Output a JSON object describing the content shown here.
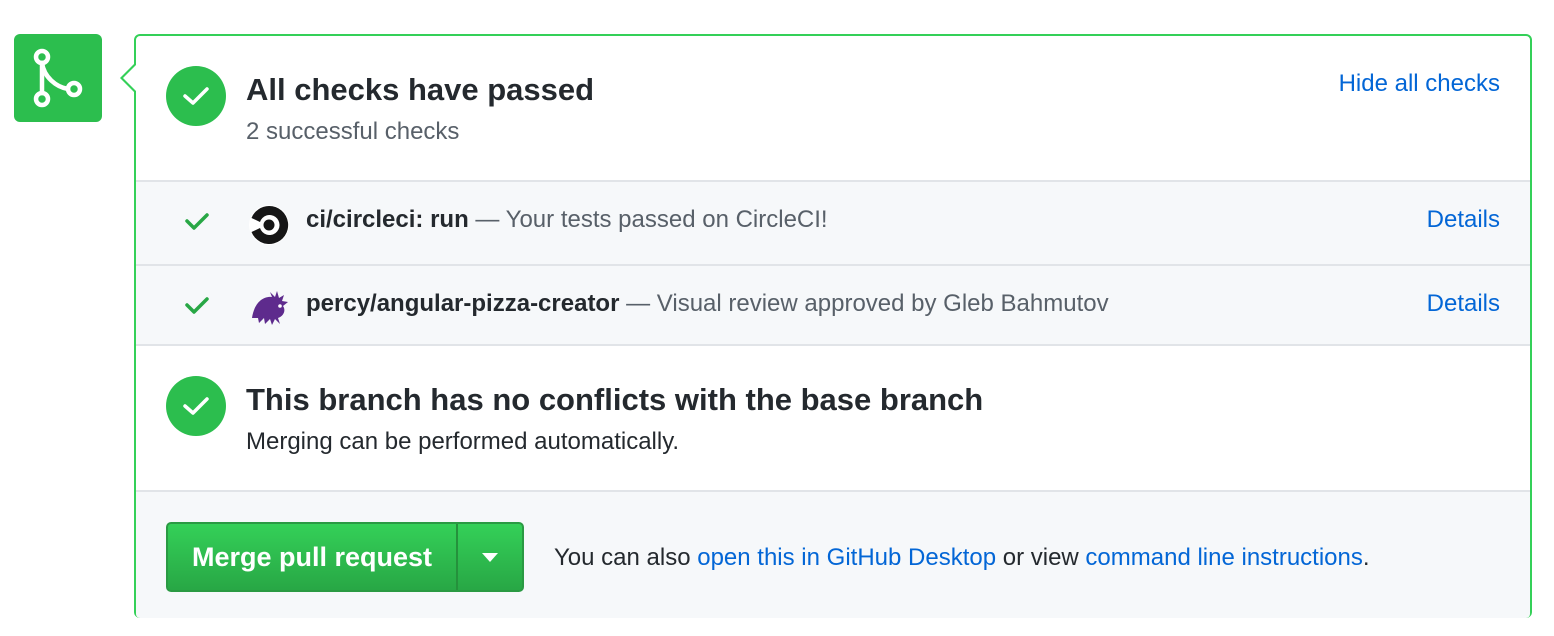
{
  "summary": {
    "title": "All checks have passed",
    "subtitle": "2 successful checks",
    "toggle_link": "Hide all checks"
  },
  "checks": [
    {
      "context": "ci/circleci: run",
      "separator": " — ",
      "description": "Your tests passed on CircleCI!",
      "details_label": "Details",
      "icon": "circleci-logo-icon"
    },
    {
      "context": "percy/angular-pizza-creator",
      "separator": " — ",
      "description": "Visual review approved by Gleb Bahmutov",
      "details_label": "Details",
      "icon": "percy-logo-icon"
    }
  ],
  "branch_status": {
    "title": "This branch has no conflicts with the base branch",
    "subtitle": "Merging can be performed automatically."
  },
  "merge": {
    "button_label": "Merge pull request",
    "alt_prefix": "You can also ",
    "desktop_link": "open this in GitHub Desktop",
    "alt_middle": " or view ",
    "cli_link": "command line instructions",
    "alt_suffix": "."
  },
  "colors": {
    "success": "#2cbe4e",
    "link": "#0366d6",
    "border": "#34d058"
  }
}
